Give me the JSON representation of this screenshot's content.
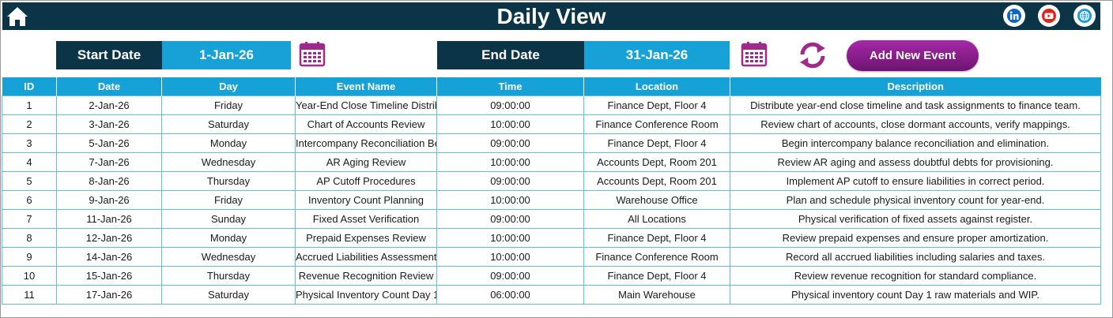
{
  "header": {
    "title": "Daily View",
    "background": "#0c3447",
    "icons": [
      "home-icon",
      "linkedin-icon",
      "youtube-icon",
      "globe-icon"
    ]
  },
  "filters": {
    "start_label": "Start Date",
    "start_value": "1-Jan-26",
    "end_label": "End Date",
    "end_value": "31-Jan-26",
    "add_button": "Add New Event",
    "accent": "#16a2d6",
    "button_color": "#8b1e8d"
  },
  "table": {
    "columns": [
      "ID",
      "Date",
      "Day",
      "Event Name",
      "Time",
      "Location",
      "Description"
    ],
    "rows": [
      [
        "1",
        "2-Jan-26",
        "Friday",
        "Year-End Close Timeline Distribution",
        "09:00:00",
        "Finance Dept, Floor 4",
        "Distribute year-end close timeline and task assignments to finance team."
      ],
      [
        "2",
        "3-Jan-26",
        "Saturday",
        "Chart of Accounts Review",
        "10:00:00",
        "Finance Conference Room",
        "Review chart of accounts, close dormant accounts, verify mappings."
      ],
      [
        "3",
        "5-Jan-26",
        "Monday",
        "Intercompany Reconciliation Begins",
        "09:00:00",
        "Finance Dept, Floor 4",
        "Begin intercompany balance reconciliation and elimination."
      ],
      [
        "4",
        "7-Jan-26",
        "Wednesday",
        "AR Aging Review",
        "10:00:00",
        "Accounts Dept, Room 201",
        "Review AR aging and assess doubtful debts for provisioning."
      ],
      [
        "5",
        "8-Jan-26",
        "Thursday",
        "AP Cutoff Procedures",
        "09:00:00",
        "Accounts Dept, Room 201",
        "Implement AP cutoff to ensure liabilities in correct period."
      ],
      [
        "6",
        "9-Jan-26",
        "Friday",
        "Inventory Count Planning",
        "10:00:00",
        "Warehouse Office",
        "Plan and schedule physical inventory count for year-end."
      ],
      [
        "7",
        "11-Jan-26",
        "Sunday",
        "Fixed Asset Verification",
        "09:00:00",
        "All Locations",
        "Physical verification of fixed assets against register."
      ],
      [
        "8",
        "12-Jan-26",
        "Monday",
        "Prepaid Expenses Review",
        "10:00:00",
        "Finance Dept, Floor 4",
        "Review prepaid expenses and ensure proper amortization."
      ],
      [
        "9",
        "14-Jan-26",
        "Wednesday",
        "Accrued Liabilities Assessment",
        "10:00:00",
        "Finance Conference Room",
        "Record all accrued liabilities including salaries and taxes."
      ],
      [
        "10",
        "15-Jan-26",
        "Thursday",
        "Revenue Recognition Review",
        "09:00:00",
        "Finance Dept, Floor 4",
        "Review revenue recognition for standard compliance."
      ],
      [
        "11",
        "17-Jan-26",
        "Saturday",
        "Physical Inventory Count Day 1",
        "06:00:00",
        "Main Warehouse",
        "Physical inventory count Day 1 raw materials and WIP."
      ]
    ]
  }
}
